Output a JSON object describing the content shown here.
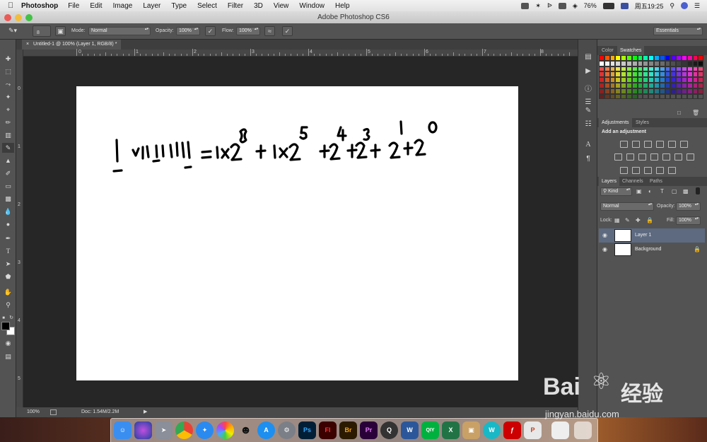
{
  "menubar": {
    "app_name": "Photoshop",
    "menus": [
      "File",
      "Edit",
      "Image",
      "Layer",
      "Type",
      "Select",
      "Filter",
      "3D",
      "View",
      "Window",
      "Help"
    ],
    "battery": "76%",
    "clock": "周五19:25"
  },
  "window": {
    "title": "Adobe Photoshop CS6"
  },
  "options_bar": {
    "brush_size": "8",
    "mode_label": "Mode:",
    "mode_value": "Normal",
    "opacity_label": "Opacity:",
    "opacity_value": "100%",
    "flow_label": "Flow:",
    "flow_value": "100%",
    "workspace": "Essentials"
  },
  "document": {
    "tab_title": "Untitled-1 @ 100% (Layer 1, RGB/8) *",
    "ruler_h": [
      "0",
      "1",
      "2",
      "3",
      "4",
      "5",
      "6",
      "7",
      "8"
    ],
    "ruler_v": [
      "0",
      "1",
      "2",
      "3",
      "4",
      "5"
    ],
    "zoom": "100%",
    "doc_size": "Doc: 1.54M/2.2M",
    "drawing": {
      "color": "#000000"
    }
  },
  "panels": {
    "color_tab": "Color",
    "swatches_tab": "Swatches",
    "adjustments_tab": "Adjustments",
    "styles_tab": "Styles",
    "add_adjustment": "Add an adjustment",
    "layers_tab": "Layers",
    "channels_tab": "Channels",
    "paths_tab": "Paths",
    "kind": "Kind",
    "blend_mode": "Normal",
    "opacity_label": "Opacity:",
    "opacity_value": "100%",
    "lock_label": "Lock:",
    "fill_label": "Fill:",
    "fill_value": "100%",
    "layers": [
      {
        "name": "Layer 1",
        "selected": true
      },
      {
        "name": "Background",
        "locked": true
      }
    ]
  },
  "dock": {
    "labels": [
      "Ps",
      "Fl",
      "Br",
      "Pr",
      "W",
      "QIY",
      "X",
      "W"
    ]
  },
  "watermark": {
    "brand": "Bai",
    "brand2": "经验",
    "url": "jingyan.baidu.com"
  }
}
